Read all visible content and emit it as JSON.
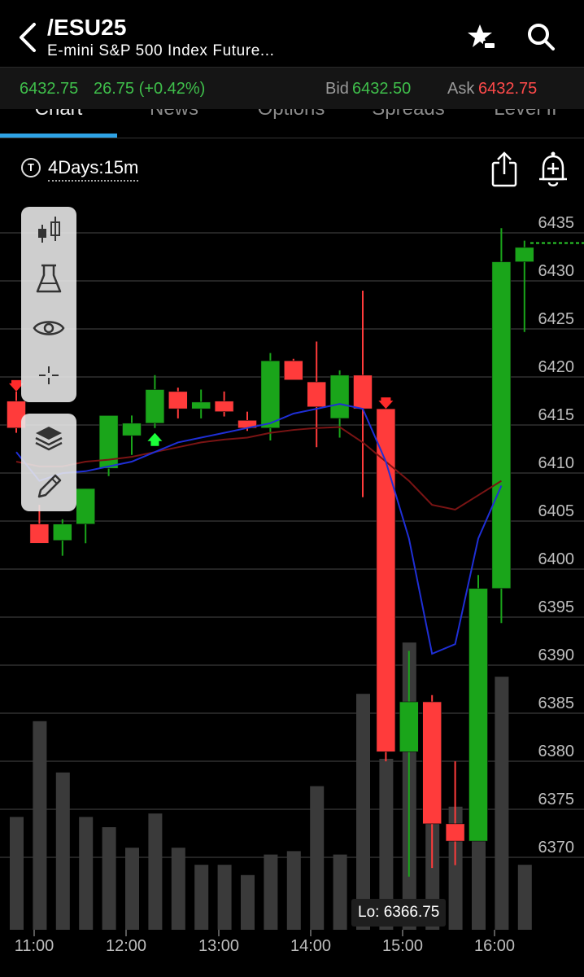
{
  "header": {
    "symbol": "/ESU25",
    "subtitle": "E-mini S&P 500 Index Future..."
  },
  "quote": {
    "last": "6432.75",
    "change": "26.75 (+0.42%)",
    "bid_label": "Bid",
    "bid": "6432.50",
    "ask_label": "Ask",
    "ask": "6432.75",
    "up_color": "#3fbf4b",
    "down_color": "#ff4a4a"
  },
  "tabs": [
    {
      "label": "Chart",
      "active": true
    },
    {
      "label": "News"
    },
    {
      "label": "Options"
    },
    {
      "label": "Spreads"
    },
    {
      "label": "Level II"
    }
  ],
  "period": {
    "icon_letter": "T",
    "label": "4Days:15m"
  },
  "toolbox": {
    "group1": [
      "candlestick-icon",
      "flask-icon",
      "eye-icon",
      "crosshair-icon"
    ],
    "group2": [
      "layers-icon",
      "pencil-icon"
    ]
  },
  "lo_label": "Lo: 6366.75",
  "chart_data": {
    "type": "candlestick",
    "y_axis_ticks": [
      6435,
      6430,
      6425,
      6420,
      6415,
      6410,
      6405,
      6400,
      6395,
      6390,
      6385,
      6380,
      6375,
      6370
    ],
    "ylim": [
      6360,
      6438
    ],
    "x_axis_ticks": [
      "11:00",
      "12:00",
      "13:00",
      "14:00",
      "15:00",
      "16:00"
    ],
    "last_price": 6432.75,
    "colors": {
      "up": "#1aa51a",
      "down": "#ff3b3b",
      "ema_fast": "#1f2fd6",
      "ema_slow": "#7a1414",
      "volume": "#3a3a3a"
    },
    "candles": [
      {
        "o": 6416.3,
        "h": 6417.3,
        "l": 6413.0,
        "c": 6413.5
      },
      {
        "o": 6403.5,
        "h": 6405.5,
        "l": 6401.5,
        "c": 6401.5
      },
      {
        "o": 6401.8,
        "h": 6404.0,
        "l": 6400.2,
        "c": 6403.5
      },
      {
        "o": 6403.5,
        "h": 6407.2,
        "l": 6401.5,
        "c": 6407.2
      },
      {
        "o": 6409.3,
        "h": 6414.8,
        "l": 6408.5,
        "c": 6414.8
      },
      {
        "o": 6412.7,
        "h": 6414.8,
        "l": 6410.7,
        "c": 6414.0
      },
      {
        "o": 6414.0,
        "h": 6419.0,
        "l": 6413.5,
        "c": 6417.5
      },
      {
        "o": 6417.3,
        "h": 6417.7,
        "l": 6414.5,
        "c": 6415.5
      },
      {
        "o": 6415.5,
        "h": 6417.5,
        "l": 6414.5,
        "c": 6416.2
      },
      {
        "o": 6416.3,
        "h": 6417.3,
        "l": 6414.7,
        "c": 6415.2
      },
      {
        "o": 6414.3,
        "h": 6415.2,
        "l": 6413.2,
        "c": 6413.5
      },
      {
        "o": 6413.5,
        "h": 6421.3,
        "l": 6412.2,
        "c": 6420.5
      },
      {
        "o": 6420.5,
        "h": 6420.7,
        "l": 6418.5,
        "c": 6418.5
      },
      {
        "o": 6418.3,
        "h": 6422.5,
        "l": 6411.5,
        "c": 6415.7
      },
      {
        "o": 6414.5,
        "h": 6419.5,
        "l": 6412.5,
        "c": 6419.0
      },
      {
        "o": 6419.0,
        "h": 6427.8,
        "l": 6406.3,
        "c": 6415.5
      },
      {
        "o": 6415.5,
        "h": 6415.5,
        "l": 6378.8,
        "c": 6379.8
      },
      {
        "o": 6379.8,
        "h": 6390.3,
        "l": 6366.8,
        "c": 6385.0
      },
      {
        "o": 6385.0,
        "h": 6385.7,
        "l": 6367.7,
        "c": 6372.3
      },
      {
        "o": 6372.3,
        "h": 6378.8,
        "l": 6368.0,
        "c": 6370.5
      },
      {
        "o": 6370.5,
        "h": 6398.2,
        "l": 6370.5,
        "c": 6396.8
      },
      {
        "o": 6396.8,
        "h": 6434.3,
        "l": 6393.2,
        "c": 6430.8
      },
      {
        "o": 6430.8,
        "h": 6433.0,
        "l": 6423.5,
        "c": 6432.3
      }
    ],
    "ema_fast": [
      6411,
      6408,
      6408.8,
      6409,
      6409.5,
      6410,
      6411,
      6412,
      6412.5,
      6413,
      6413.5,
      6414,
      6415,
      6415.5,
      6416,
      6415.5,
      6410,
      6402,
      6390,
      6391,
      6402,
      6407.5
    ],
    "ema_slow": [
      6410,
      6409.5,
      6409.5,
      6410,
      6410.2,
      6410.5,
      6411,
      6411.5,
      6412,
      6412.3,
      6412.5,
      6413,
      6413.3,
      6413.5,
      6413.6,
      6412,
      6410,
      6408,
      6405.5,
      6405,
      6406.5,
      6408
    ],
    "volume": [
      0.33,
      0.61,
      0.46,
      0.33,
      0.3,
      0.24,
      0.34,
      0.24,
      0.19,
      0.19,
      0.16,
      0.22,
      0.23,
      0.42,
      0.22,
      0.69,
      0.5,
      0.84,
      0.46,
      0.36,
      0.77,
      0.74,
      0.19
    ],
    "signals": [
      {
        "candle": 0,
        "dir": "down"
      },
      {
        "candle": 6,
        "dir": "up"
      },
      {
        "candle": 16,
        "dir": "down"
      }
    ]
  }
}
